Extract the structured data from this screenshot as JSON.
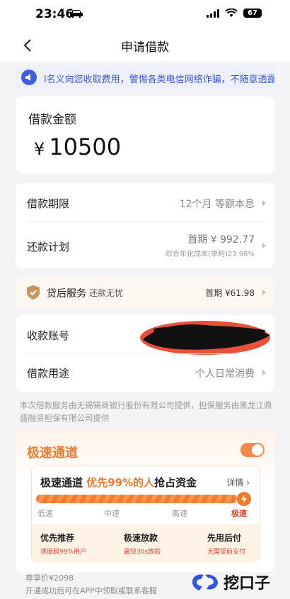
{
  "status_bar": {
    "time": "23:46",
    "battery": "67"
  },
  "nav": {
    "title": "申请借款"
  },
  "notice": {
    "text": "l名义向您收取费用，警惕各类电信网络诈骗，不随意透露身"
  },
  "amount": {
    "label": "借款金额",
    "currency": "¥",
    "value": "10500"
  },
  "loan": {
    "term_label": "借款期限",
    "term_value": "12个月 等额本息",
    "plan_label": "还款计划",
    "plan_value": "首期 ¥ 992.77",
    "plan_sub": "综合年化成本(单利)23.98%"
  },
  "service": {
    "label": "贷后服务",
    "sub": "还款无忧",
    "value": "首期 ¥61.98"
  },
  "account": {
    "label": "收款账号",
    "purpose_label": "借款用途",
    "purpose_value": "个人日常消费"
  },
  "disclaimer": "本次借款服务由无锡锡商银行股份有限公司提供，担保服务由黑龙江鼎盛融资担保有限公司提供",
  "express": {
    "title": "极速通道",
    "toggle_on": true,
    "headline_prefix": "极速通道",
    "headline_highlight": "优先99%的人",
    "headline_suffix": "抢占资金",
    "details_label": "详情",
    "progress": 0.98,
    "speed_labels": [
      "低速",
      "中速",
      "高速",
      "极速"
    ],
    "features": [
      {
        "title": "优先推荐",
        "sub": "速度超99%用户"
      },
      {
        "title": "极速放款",
        "sub": "最快30s放款"
      },
      {
        "title": "先用后付",
        "sub": "无需提前支付"
      }
    ]
  },
  "price": {
    "label": "尊享价¥2098",
    "note": "开通成功后可在APP中领取或联系客服"
  },
  "watermark": {
    "text": "挖口子"
  },
  "colors": {
    "accent": "#f07a2c",
    "notice_blue": "#3a56d8"
  }
}
